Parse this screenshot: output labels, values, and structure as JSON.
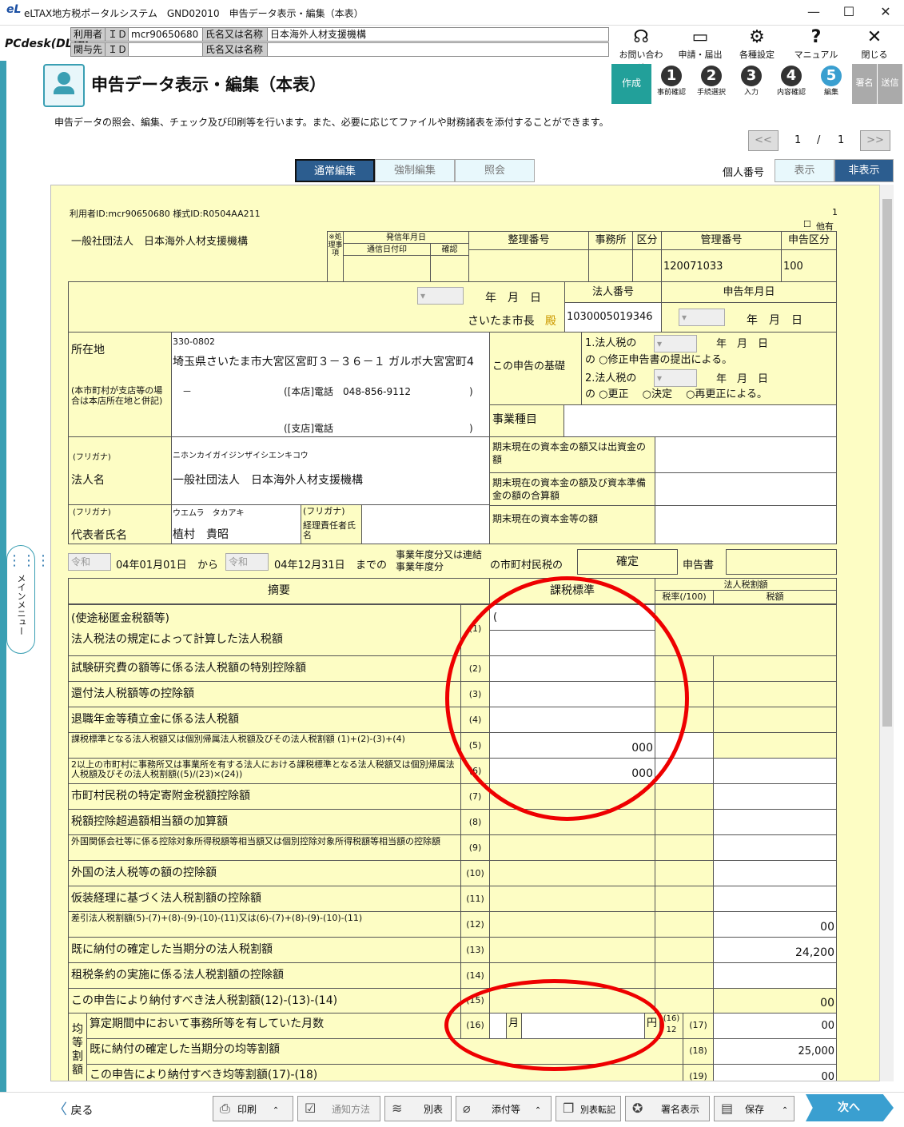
{
  "window": {
    "title": "eLTAX地方税ポータルシステム　GND02010　申告データ表示・編集（本表）",
    "logo": "eL"
  },
  "info": {
    "user_label": "利用者",
    "id_label": "ＩＤ",
    "user_id": "mcr90650680",
    "name_label": "氏名又は名称",
    "user_name": "日本海外人材支援機構",
    "related_label": "関与先",
    "related_id_label": "ＩＤ",
    "related_name_label": "氏名又は名称",
    "app_logo": "PCdesk(DL版)"
  },
  "toolbar": {
    "inquiry": "お問い合わせ",
    "apply": "申請・届出",
    "settings": "各種設定",
    "manual": "マニュアル",
    "close": "閉じる"
  },
  "page": {
    "title": "申告データ表示・編集（本表）",
    "description": "申告データの照会、編集、チェック及び印刷等を行います。また、必要に応じてファイルや財務諸表を添付することができます。"
  },
  "steps": {
    "create": "作成",
    "s1": "事前確認",
    "s2": "手続選択",
    "s3": "入力",
    "s4": "内容確認",
    "s5": "編集",
    "sign": "署名",
    "send": "送信"
  },
  "pager": {
    "current": "1",
    "sep": "/",
    "total": "1",
    "prev": "<<",
    "next": ">>"
  },
  "modes": {
    "normal": "通常編集",
    "force": "強制編集",
    "view": "照会"
  },
  "personal": {
    "label": "個人番号",
    "show": "表示",
    "hide": "非表示"
  },
  "form": {
    "user_line": "利用者ID:mcr90650680 様式ID:R0504AA211",
    "page_no": "1",
    "other_label": "他有",
    "corp_header": "一般社団法人　日本海外人材支援機構",
    "proc_label": "※処理事項",
    "sent_date": "発信年月日",
    "notice_date": "通信日付印",
    "confirm": "確認",
    "seiri": "整理番号",
    "office": "事務所",
    "kubun": "区分",
    "kanri": "管理番号",
    "shinkoku_kubun": "申告区分",
    "kanri_value": "120071033",
    "kubun_value": "100",
    "nengappi": "年　月　日",
    "mayor": "さいたま市長",
    "dono": "殿",
    "houjin_no_label": "法人番号",
    "houjin_no": "1030005019346",
    "shinkoku_date_label": "申告年月日",
    "address_label": "所在地",
    "address_note": "(本市町村が支店等の場合は本店所在地と併記)",
    "postal": "330-0802",
    "address": "埼玉県さいたま市大宮区宮町３－３６－１ ガルボ大宮宮町4",
    "dash": "－",
    "honten_tel": "([本店]電話　048-856-9112",
    "close_paren": ")",
    "shiten_tel": "([支店]電話",
    "basis_label": "この申告の基礎",
    "basis1": "1.法人税の",
    "basis1b": "の ○修正申告書の提出による。",
    "basis2": "2.法人税の",
    "basis2b": "の ○更正　 ○決定　 ○再更正による。",
    "year_month_day": "年　月　日",
    "business_label": "事業種目",
    "furigana": "(フリガナ)",
    "corp_kana": "ニホンカイガイジンザイシエンキコウ",
    "corp_name_label": "法人名",
    "corp_name": "一般社団法人　日本海外人材支援機構",
    "cap1": "期末現在の資本金の額又は出資金の額",
    "cap2": "期末現在の資本金の額及び資本準備金の額の合算額",
    "cap3": "期末現在の資本金等の額",
    "rep_label": "代表者氏名",
    "rep_kana": "ウエムラ　タカアキ",
    "rep_name": "植村　貴昭",
    "acct_label": "経理責任者氏名",
    "era1": "令和",
    "from_date": "04年01月01日",
    "from": "から",
    "era2": "令和",
    "to_date": "04年12月31日",
    "made": "までの",
    "period_label": "事業年度分又は連結事業年度分",
    "tax_kind": "の市町村民税の",
    "kakutei": "確定",
    "shinkokusho": "申告書",
    "col_tekiyou": "摘要",
    "col_base": "課税標準",
    "col_houjin": "法人税割額",
    "col_rate": "税率(/100)",
    "col_tax": "税額",
    "rows": [
      {
        "label": "(使途秘匿金税額等)",
        "no": ""
      },
      {
        "label": "法人税法の規定によって計算した法人税額",
        "no": "(1)"
      },
      {
        "label": "試験研究費の額等に係る法人税額の特別控除額",
        "no": "(2)"
      },
      {
        "label": "還付法人税額等の控除額",
        "no": "(3)"
      },
      {
        "label": "退職年金等積立金に係る法人税額",
        "no": "(4)"
      },
      {
        "label": "課税標準となる法人税額又は個別帰属法人税額及びその法人税割額 (1)+(2)-(3)+(4)",
        "no": "(5)",
        "base": "000"
      },
      {
        "label": "2以上の市町村に事務所又は事業所を有する法人における課税標準となる法人税額又は個別帰属法人税額及びその法人税割額((5)/(23)×(24))",
        "no": "(6)",
        "base": "000"
      },
      {
        "label": "市町村民税の特定寄附金税額控除額",
        "no": "(7)"
      },
      {
        "label": "税額控除超過額相当額の加算額",
        "no": "(8)"
      },
      {
        "label": "外国関係会社等に係る控除対象所得税額等相当額又は個別控除対象所得税額等相当額の控除額",
        "no": "(9)"
      },
      {
        "label": "外国の法人税等の額の控除額",
        "no": "(10)"
      },
      {
        "label": "仮装経理に基づく法人税割額の控除額",
        "no": "(11)"
      },
      {
        "label": "差引法人税割額(5)-(7)+(8)-(9)-(10)-(11)又は(6)-(7)+(8)-(9)-(10)-(11)",
        "no": "(12)",
        "tax": "00"
      },
      {
        "label": "既に納付の確定した当期分の法人税割額",
        "no": "(13)",
        "tax": "24,200"
      },
      {
        "label": "租税条約の実施に係る法人税割額の控除額",
        "no": "(14)"
      },
      {
        "label": "この申告により納付すべき法人税割額(12)-(13)-(14)",
        "no": "(15)",
        "tax": "00"
      }
    ],
    "kinto_label": "均等割額",
    "r16_label": "算定期間中において事務所等を有していた月数",
    "r16_no": "(16)",
    "month": "月",
    "yen": "円",
    "frac_top": "(16)",
    "frac_bot": "12",
    "r17_no": "(17)",
    "r17_val": "00",
    "r18_label": "既に納付の確定した当期分の均等割額",
    "r18_no": "(18)",
    "r18_val": "25,000",
    "r19_label": "この申告により納付すべき均等割額(17)-(18)",
    "r19_no": "(19)",
    "r19_val": "00"
  },
  "bottom": {
    "back": "戻る",
    "print": "印刷",
    "notify": "通知方法",
    "beppyo": "別表",
    "attach": "添付等",
    "beppyo_trans": "別表転記",
    "sign_show": "署名表示",
    "save": "保存",
    "next": "次へ"
  },
  "menu": {
    "label": "メインメニュー"
  }
}
